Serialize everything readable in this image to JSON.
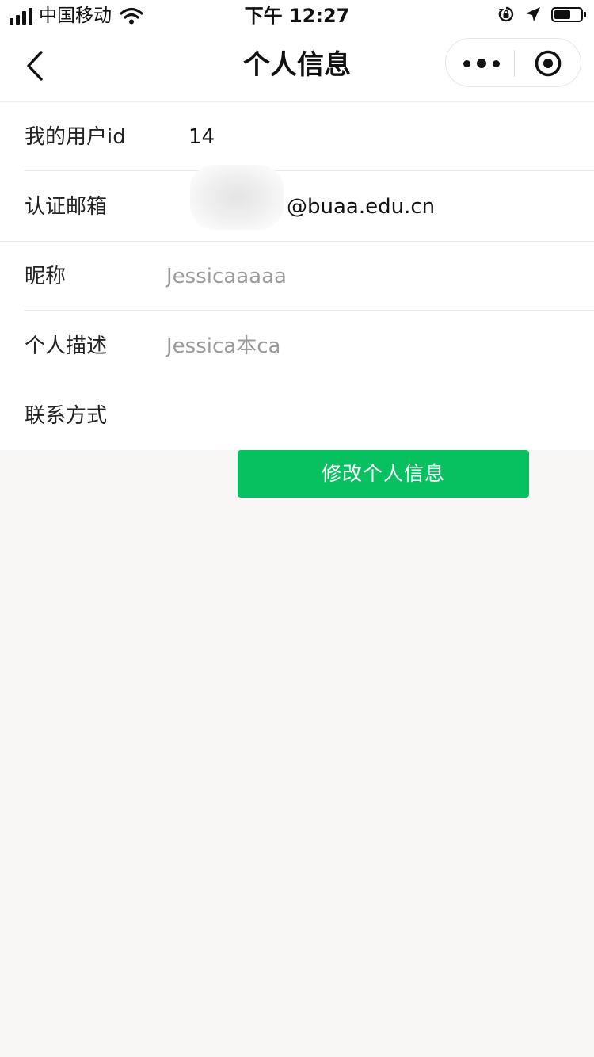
{
  "status_bar": {
    "carrier": "中国移动",
    "time": "下午 12:27",
    "battery_level": 0.6
  },
  "nav": {
    "title": "个人信息",
    "icons": [
      "back-arrow-icon",
      "more-icon",
      "target-icon"
    ]
  },
  "form": {
    "user_id": {
      "label": "我的用户id",
      "value": "14"
    },
    "email": {
      "label": "认证邮箱",
      "value": "@buaa.edu.cn"
    },
    "nickname": {
      "label": "昵称",
      "placeholder": "Jessicaaaaa"
    },
    "description": {
      "label": "个人描述",
      "placeholder": "Jessica本ca"
    },
    "contact": {
      "label": "联系方式",
      "value": ""
    }
  },
  "submit_label": "修改个人信息",
  "colors": {
    "accent": "#07c160",
    "background": "#f8f7f6",
    "placeholder": "#9b9b9b"
  }
}
